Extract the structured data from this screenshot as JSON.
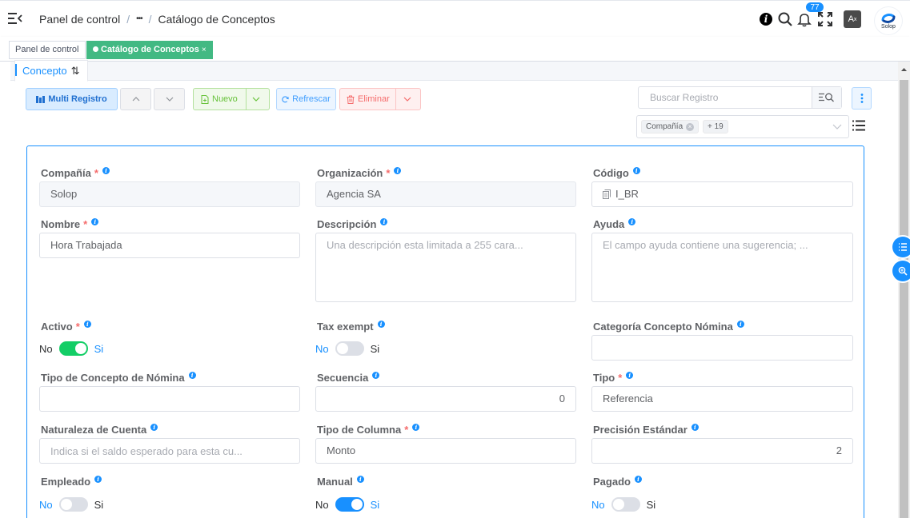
{
  "header": {
    "breadcrumb": [
      "Panel de control",
      "•••",
      "Catálogo de Conceptos"
    ],
    "notification_count": "77",
    "translate_glyph": "A",
    "avatar_label": "Solop"
  },
  "tags_view": {
    "tags": [
      {
        "label": "Panel de control",
        "active": false
      },
      {
        "label": "Catálogo de Conceptos",
        "active": true,
        "close": "×"
      }
    ]
  },
  "tab": {
    "label": "Concepto",
    "sort_glyph": "⇅"
  },
  "toolbar": {
    "multi_label": "Multi Registro",
    "new_label": "Nuevo",
    "refresh_label": "Refrescar",
    "delete_label": "Eliminar"
  },
  "search": {
    "placeholder": "Buscar Registro"
  },
  "filter": {
    "chips": [
      "Compañía",
      "+ 19"
    ]
  },
  "form": {
    "company": {
      "label": "Compañía",
      "required": "*",
      "value": "Solop"
    },
    "organization": {
      "label": "Organización",
      "required": "*",
      "value": "Agencia SA"
    },
    "code": {
      "label": "Código",
      "value": "I_BR"
    },
    "name": {
      "label": "Nombre",
      "required": "*",
      "value": "Hora Trabajada"
    },
    "description": {
      "label": "Descripción",
      "placeholder": "Una descripción esta limitada a 255 cara..."
    },
    "help": {
      "label": "Ayuda",
      "placeholder": "El campo ayuda contiene una sugerencia; ..."
    },
    "active": {
      "label": "Activo",
      "required": "*",
      "off": "No",
      "on": "Si",
      "value": true
    },
    "tax_exempt": {
      "label": "Tax exempt",
      "off": "No",
      "on": "Si",
      "value": false
    },
    "payroll_category": {
      "label": "Categoría Concepto Nómina",
      "value": ""
    },
    "payroll_type": {
      "label": "Tipo de Concepto de Nómina",
      "value": ""
    },
    "sequence": {
      "label": "Secuencia",
      "value": "0"
    },
    "type": {
      "label": "Tipo",
      "required": "*",
      "value": "Referencia"
    },
    "account_nature": {
      "label": "Naturaleza de Cuenta",
      "placeholder": "Indica si el saldo esperado para esta cu..."
    },
    "column_type": {
      "label": "Tipo de Columna",
      "required": "*",
      "value": "Monto"
    },
    "std_precision": {
      "label": "Precisión Estándar",
      "value": "2"
    },
    "employee": {
      "label": "Empleado",
      "off": "No",
      "on": "Si",
      "value": false
    },
    "manual": {
      "label": "Manual",
      "off": "No",
      "on": "Si",
      "value": true
    },
    "paid": {
      "label": "Pagado",
      "off": "No",
      "on": "Si",
      "value": false
    }
  },
  "colors": {
    "primary": "#1890ff",
    "success": "#13ce66",
    "tag_active": "#42b983",
    "danger": "#f56c6c"
  }
}
